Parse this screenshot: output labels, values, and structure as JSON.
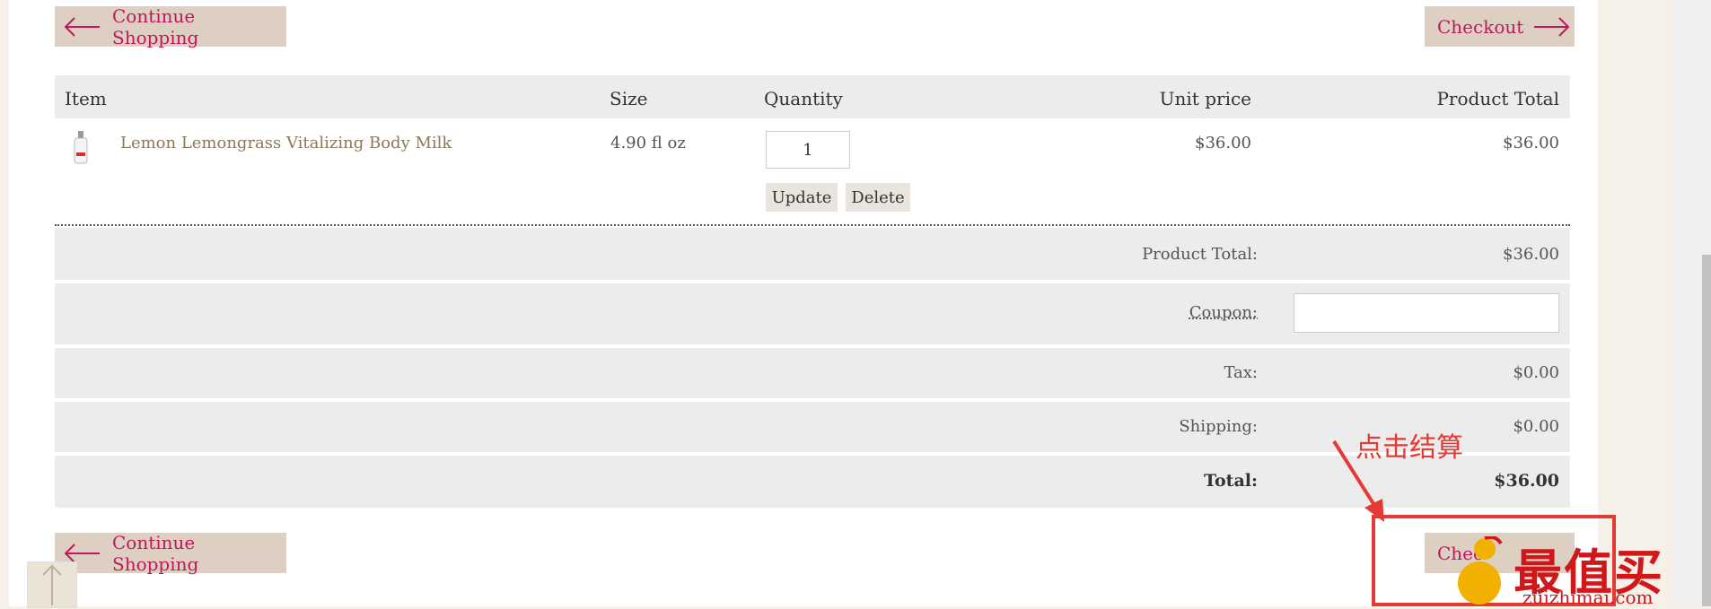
{
  "nav": {
    "continue_label": "Continue Shopping",
    "checkout_label": "Checkout",
    "checkout_partial": "Chec"
  },
  "table": {
    "headers": {
      "item": "Item",
      "size": "Size",
      "quantity": "Quantity",
      "unit_price": "Unit price",
      "product_total": "Product Total"
    },
    "rows": [
      {
        "name": "Lemon Lemongrass Vitalizing Body Milk",
        "size": "4.90 fl oz",
        "quantity": "1",
        "unit_price": "$36.00",
        "product_total": "$36.00",
        "update_label": "Update",
        "delete_label": "Delete"
      }
    ]
  },
  "summary": {
    "product_total_label": "Product Total:",
    "product_total_value": "$36.00",
    "coupon_label": "Coupon:",
    "coupon_value": "",
    "tax_label": "Tax:",
    "tax_value": "$0.00",
    "shipping_label": "Shipping:",
    "shipping_value": "$0.00",
    "total_label": "Total:",
    "total_value": "$36.00"
  },
  "annotation": {
    "text": "点击结算",
    "color": "#e53935"
  },
  "watermark": {
    "main": "最值买",
    "sub": "zuizhimai.com"
  },
  "colors": {
    "accent": "#c2185b",
    "button_bg": "#ddd0c2",
    "row_bg": "#ececec",
    "product_link": "#8a7a5a",
    "page_bg": "#f5f1e8"
  },
  "icons": [
    "arrow-left-icon",
    "arrow-right-icon",
    "product-thumbnail",
    "arrow-up-icon"
  ]
}
